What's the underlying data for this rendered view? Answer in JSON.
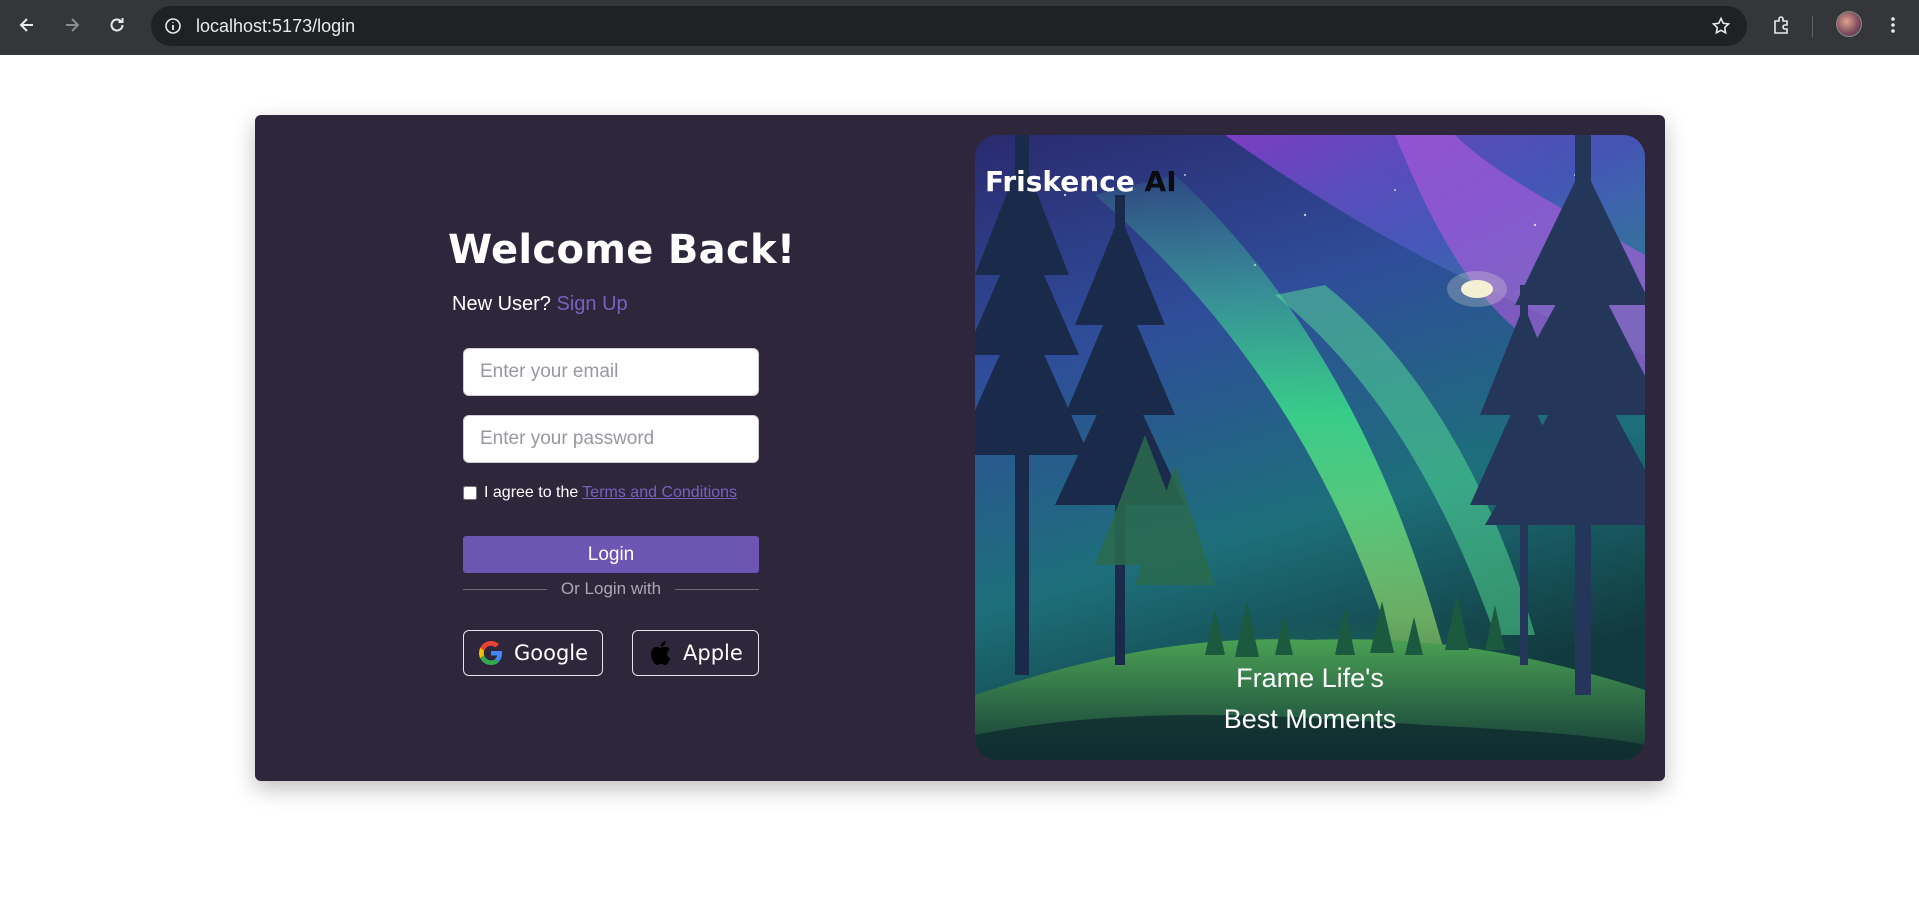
{
  "browser": {
    "url": "localhost:5173/login"
  },
  "login": {
    "title": "Welcome Back!",
    "new_user_text": "New User?",
    "signup_link": "Sign Up",
    "email_placeholder": "Enter your email",
    "password_placeholder": "Enter your password",
    "terms_prefix": "I agree to the",
    "terms_link": "Terms and Conditions",
    "login_button": "Login",
    "divider_text": "Or Login with",
    "google_button": "Google",
    "apple_button": "Apple"
  },
  "hero": {
    "brand_main": "Friskence",
    "brand_suffix": "AI",
    "tagline_line1": "Frame Life's",
    "tagline_line2": "Best Moments"
  },
  "colors": {
    "card_bg": "#2e273b",
    "accent": "#6c55b3",
    "link": "#7b5fbf"
  }
}
